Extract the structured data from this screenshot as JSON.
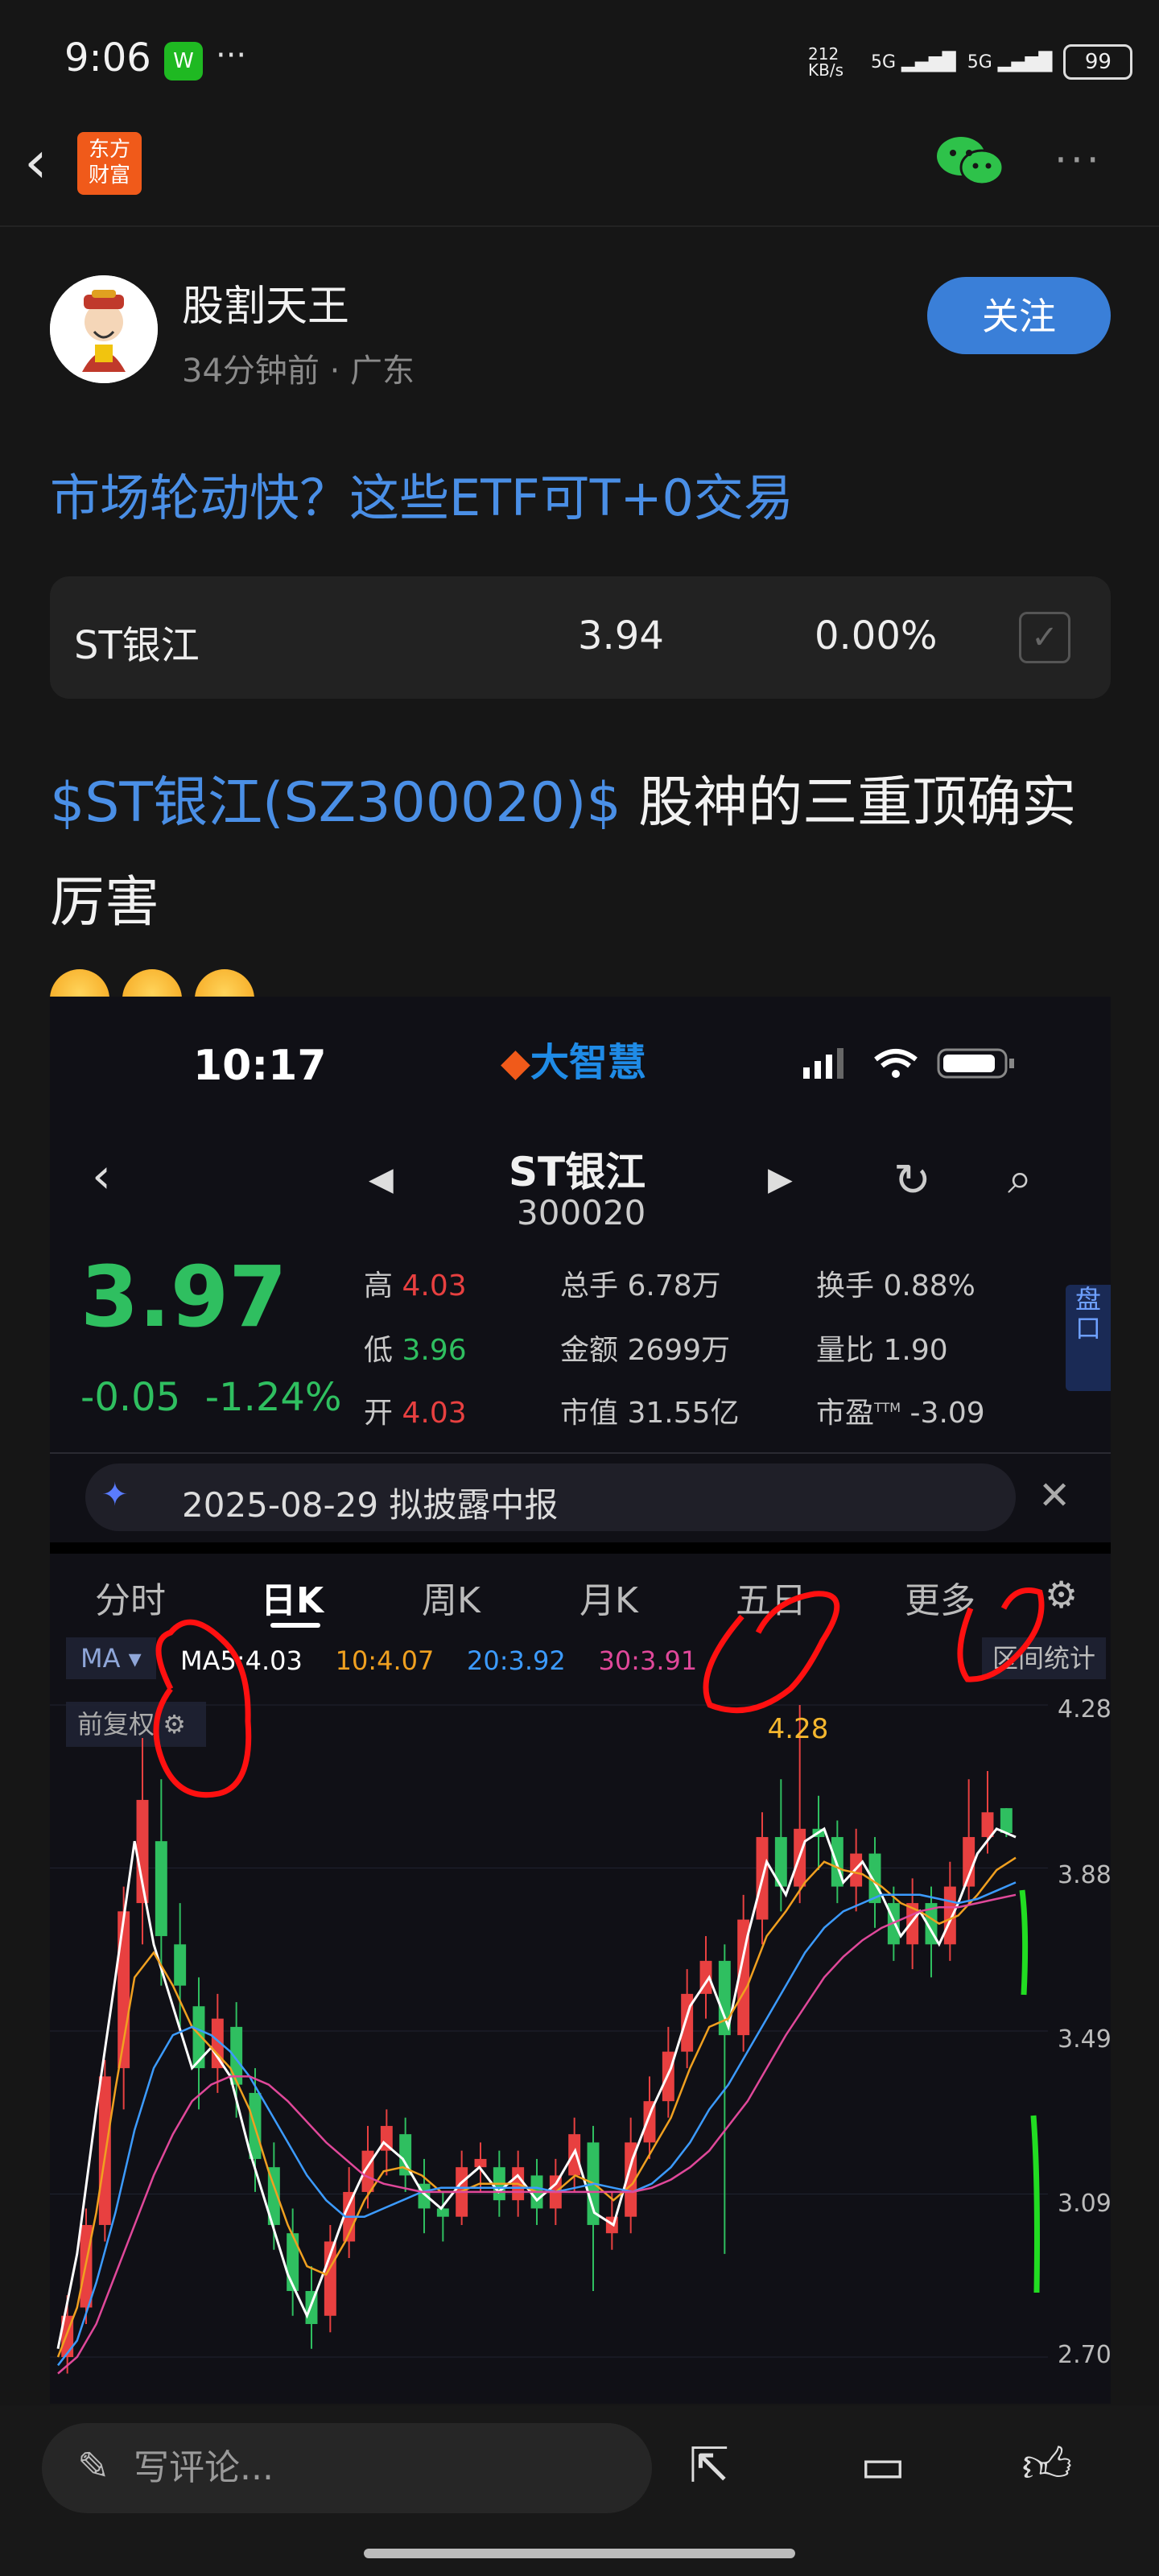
{
  "status_bar": {
    "time": "9:06",
    "chat_app_label": "W",
    "dots": "···",
    "speed": "212\nKB/s",
    "signal1": "5G",
    "signal2": "5G",
    "battery": "99"
  },
  "nav": {
    "logo_line1": "东方",
    "logo_line2": "财富"
  },
  "author": {
    "name": "股割天王",
    "meta": "34分钟前 · 广东",
    "follow_label": "关注"
  },
  "title_link": "市场轮动快？这些ETF可T+0交易",
  "stock_card": {
    "name": "ST银江",
    "price": "3.94",
    "change": "0.00%"
  },
  "post": {
    "cashtag": "$ST银江(SZ300020)$",
    "text": " 股神的三重顶确实厉害"
  },
  "screenshot": {
    "time": "10:17",
    "brand": "大智慧",
    "stock_name": "ST银江",
    "stock_code": "300020",
    "price": "3.97",
    "change": "-0.05  -1.24%",
    "quote": {
      "high_label": "高",
      "high": "4.03",
      "low_label": "低",
      "low": "3.96",
      "open_label": "开",
      "open": "4.03",
      "volume_label": "总手",
      "volume": "6.78万",
      "amount_label": "金额",
      "amount": "2699万",
      "mktcap_label": "市值",
      "mktcap": "31.55亿",
      "turnover_label": "换手",
      "turnover": "0.88%",
      "vol_ratio_label": "量比",
      "vol_ratio": "1.90",
      "pe_label": "市盈",
      "pe_tag": "TTM",
      "pe": "-3.09"
    },
    "pankou": "盘口",
    "notice": "2025-08-29 拟披露中报",
    "tabs": [
      "分时",
      "日K",
      "周K",
      "月K",
      "五日",
      "更多"
    ],
    "ma_label": "MA",
    "ma": {
      "ma5": "MA5:4.03",
      "ma10": "10:4.07",
      "ma20": "20:3.92",
      "ma30": "30:3.91"
    },
    "qujian": "区间统计",
    "fuquan": "前复权",
    "peak_label": "4.28",
    "colors": {
      "ma5": "#ffffff",
      "ma10": "#f0a020",
      "ma20": "#3c9bff",
      "ma30": "#e0489a",
      "up": "#e84040",
      "down": "#2fbf60",
      "annotation": "#ff1010"
    }
  },
  "chart_data": {
    "type": "line",
    "title": "",
    "xlabel": "",
    "ylabel": "",
    "y_ticks": [
      "4.28",
      "3.88",
      "3.49",
      "3.09",
      "2.70"
    ],
    "ylim": [
      2.7,
      4.28
    ],
    "series": [
      {
        "name": "MA5",
        "values": [
          2.72,
          2.95,
          3.3,
          3.62,
          3.95,
          3.7,
          3.55,
          3.4,
          3.45,
          3.38,
          3.2,
          3.05,
          2.9,
          2.8,
          2.92,
          3.05,
          3.15,
          3.22,
          3.18,
          3.1,
          3.06,
          3.12,
          3.16,
          3.1,
          3.14,
          3.08,
          3.12,
          3.2,
          3.05,
          3.02,
          3.18,
          3.3,
          3.4,
          3.55,
          3.62,
          3.5,
          3.72,
          3.9,
          3.82,
          3.95,
          3.98,
          3.85,
          3.9,
          3.82,
          3.72,
          3.78,
          3.7,
          3.8,
          3.92,
          3.98,
          3.96
        ]
      },
      {
        "name": "MA10",
        "values": [
          2.7,
          2.82,
          3.05,
          3.35,
          3.62,
          3.68,
          3.6,
          3.5,
          3.45,
          3.4,
          3.3,
          3.15,
          3.02,
          2.92,
          2.9,
          2.98,
          3.08,
          3.15,
          3.16,
          3.14,
          3.1,
          3.1,
          3.12,
          3.12,
          3.12,
          3.1,
          3.1,
          3.14,
          3.12,
          3.08,
          3.12,
          3.2,
          3.28,
          3.4,
          3.5,
          3.52,
          3.6,
          3.72,
          3.78,
          3.85,
          3.9,
          3.88,
          3.87,
          3.84,
          3.8,
          3.78,
          3.75,
          3.77,
          3.82,
          3.88,
          3.91
        ]
      },
      {
        "name": "MA20",
        "values": [
          2.68,
          2.74,
          2.88,
          3.05,
          3.25,
          3.4,
          3.48,
          3.5,
          3.48,
          3.44,
          3.38,
          3.3,
          3.22,
          3.14,
          3.08,
          3.04,
          3.04,
          3.06,
          3.08,
          3.1,
          3.11,
          3.11,
          3.11,
          3.11,
          3.11,
          3.11,
          3.1,
          3.11,
          3.12,
          3.11,
          3.1,
          3.12,
          3.16,
          3.22,
          3.3,
          3.36,
          3.44,
          3.52,
          3.6,
          3.68,
          3.74,
          3.78,
          3.8,
          3.82,
          3.82,
          3.82,
          3.81,
          3.8,
          3.81,
          3.83,
          3.85
        ]
      },
      {
        "name": "MA30",
        "values": [
          2.66,
          2.7,
          2.78,
          2.9,
          3.02,
          3.14,
          3.24,
          3.32,
          3.36,
          3.38,
          3.38,
          3.36,
          3.32,
          3.27,
          3.22,
          3.18,
          3.14,
          3.12,
          3.11,
          3.1,
          3.1,
          3.1,
          3.1,
          3.1,
          3.1,
          3.1,
          3.1,
          3.1,
          3.1,
          3.1,
          3.1,
          3.11,
          3.13,
          3.16,
          3.2,
          3.26,
          3.32,
          3.4,
          3.48,
          3.55,
          3.62,
          3.67,
          3.71,
          3.74,
          3.76,
          3.78,
          3.79,
          3.79,
          3.8,
          3.81,
          3.82
        ]
      }
    ],
    "candles": [
      {
        "o": 2.7,
        "c": 2.8,
        "h": 2.85,
        "l": 2.66
      },
      {
        "o": 2.82,
        "c": 3.02,
        "h": 3.06,
        "l": 2.78
      },
      {
        "o": 3.02,
        "c": 3.38,
        "h": 3.42,
        "l": 2.98
      },
      {
        "o": 3.4,
        "c": 3.78,
        "h": 3.84,
        "l": 3.3
      },
      {
        "o": 3.8,
        "c": 4.05,
        "h": 4.2,
        "l": 3.7
      },
      {
        "o": 3.95,
        "c": 3.72,
        "h": 4.1,
        "l": 3.6
      },
      {
        "o": 3.7,
        "c": 3.6,
        "h": 3.8,
        "l": 3.5
      },
      {
        "o": 3.55,
        "c": 3.4,
        "h": 3.62,
        "l": 3.3
      },
      {
        "o": 3.4,
        "c": 3.52,
        "h": 3.58,
        "l": 3.34
      },
      {
        "o": 3.5,
        "c": 3.36,
        "h": 3.56,
        "l": 3.28
      },
      {
        "o": 3.34,
        "c": 3.18,
        "h": 3.4,
        "l": 3.1
      },
      {
        "o": 3.16,
        "c": 3.02,
        "h": 3.22,
        "l": 2.96
      },
      {
        "o": 3.0,
        "c": 2.86,
        "h": 3.06,
        "l": 2.8
      },
      {
        "o": 2.86,
        "c": 2.78,
        "h": 2.92,
        "l": 2.72
      },
      {
        "o": 2.8,
        "c": 2.98,
        "h": 3.02,
        "l": 2.76
      },
      {
        "o": 2.98,
        "c": 3.1,
        "h": 3.16,
        "l": 2.94
      },
      {
        "o": 3.1,
        "c": 3.2,
        "h": 3.26,
        "l": 3.06
      },
      {
        "o": 3.2,
        "c": 3.26,
        "h": 3.3,
        "l": 3.14
      },
      {
        "o": 3.24,
        "c": 3.14,
        "h": 3.28,
        "l": 3.1
      },
      {
        "o": 3.12,
        "c": 3.06,
        "h": 3.18,
        "l": 3.0
      },
      {
        "o": 3.06,
        "c": 3.04,
        "h": 3.1,
        "l": 2.98
      },
      {
        "o": 3.04,
        "c": 3.16,
        "h": 3.2,
        "l": 3.02
      },
      {
        "o": 3.16,
        "c": 3.18,
        "h": 3.22,
        "l": 3.1
      },
      {
        "o": 3.16,
        "c": 3.08,
        "h": 3.2,
        "l": 3.04
      },
      {
        "o": 3.08,
        "c": 3.16,
        "h": 3.2,
        "l": 3.04
      },
      {
        "o": 3.14,
        "c": 3.06,
        "h": 3.18,
        "l": 3.02
      },
      {
        "o": 3.06,
        "c": 3.14,
        "h": 3.18,
        "l": 3.02
      },
      {
        "o": 3.14,
        "c": 3.24,
        "h": 3.28,
        "l": 3.1
      },
      {
        "o": 3.22,
        "c": 3.02,
        "h": 3.26,
        "l": 2.86
      },
      {
        "o": 3.0,
        "c": 3.04,
        "h": 3.1,
        "l": 2.96
      },
      {
        "o": 3.04,
        "c": 3.22,
        "h": 3.28,
        "l": 3.0
      },
      {
        "o": 3.22,
        "c": 3.32,
        "h": 3.38,
        "l": 3.18
      },
      {
        "o": 3.32,
        "c": 3.44,
        "h": 3.5,
        "l": 3.28
      },
      {
        "o": 3.44,
        "c": 3.58,
        "h": 3.64,
        "l": 3.4
      },
      {
        "o": 3.58,
        "c": 3.66,
        "h": 3.72,
        "l": 3.52
      },
      {
        "o": 3.66,
        "c": 3.48,
        "h": 3.7,
        "l": 2.95
      },
      {
        "o": 3.48,
        "c": 3.76,
        "h": 3.82,
        "l": 3.44
      },
      {
        "o": 3.76,
        "c": 3.96,
        "h": 4.02,
        "l": 3.7
      },
      {
        "o": 3.96,
        "c": 3.84,
        "h": 4.1,
        "l": 3.78
      },
      {
        "o": 3.84,
        "c": 3.98,
        "h": 4.28,
        "l": 3.8
      },
      {
        "o": 3.98,
        "c": 3.96,
        "h": 4.06,
        "l": 3.88
      },
      {
        "o": 3.96,
        "c": 3.84,
        "h": 4.0,
        "l": 3.8
      },
      {
        "o": 3.84,
        "c": 3.92,
        "h": 3.98,
        "l": 3.78
      },
      {
        "o": 3.92,
        "c": 3.8,
        "h": 3.96,
        "l": 3.74
      },
      {
        "o": 3.8,
        "c": 3.7,
        "h": 3.84,
        "l": 3.66
      },
      {
        "o": 3.7,
        "c": 3.8,
        "h": 3.86,
        "l": 3.64
      },
      {
        "o": 3.8,
        "c": 3.7,
        "h": 3.84,
        "l": 3.62
      },
      {
        "o": 3.7,
        "c": 3.84,
        "h": 3.9,
        "l": 3.66
      },
      {
        "o": 3.84,
        "c": 3.96,
        "h": 4.1,
        "l": 3.8
      },
      {
        "o": 3.96,
        "c": 4.02,
        "h": 4.12,
        "l": 3.92
      },
      {
        "o": 4.03,
        "c": 3.97,
        "h": 4.03,
        "l": 3.96
      }
    ],
    "annotations": [
      "three hand-drawn red circles marking peaks",
      "two hand-drawn green vertical strokes on right side"
    ]
  },
  "bottom": {
    "comment_placeholder": "写评论..."
  }
}
